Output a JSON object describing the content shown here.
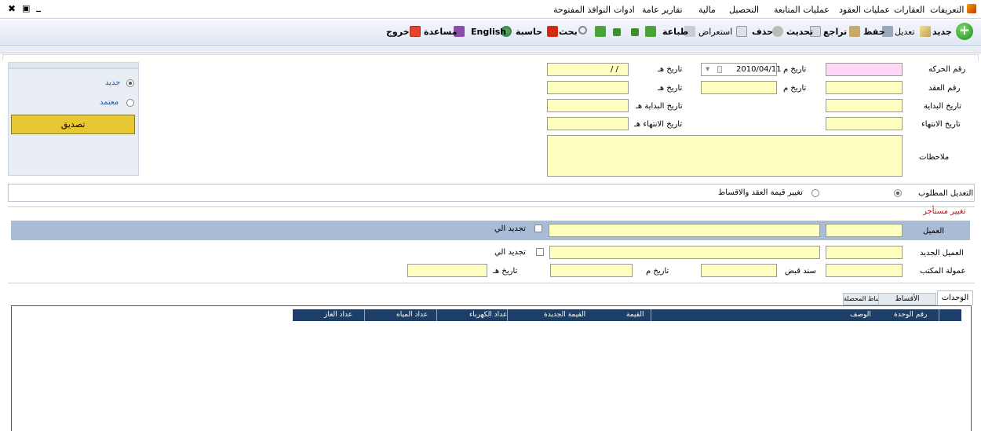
{
  "menubar": {
    "items": [
      "التعريفات",
      "العقارات",
      "عمليات العقود",
      "عمليات المتابعة",
      "التحصيل",
      "مالية",
      "تقارير عامة",
      "ادوات",
      "النوافذ المفتوحة"
    ],
    "window_controls": {
      "minimize": "_",
      "restore": "▣",
      "close": "✖"
    }
  },
  "toolbar": {
    "new": "جديد",
    "edit": "تعديل",
    "save": "حفظ",
    "undo": "تراجع",
    "refresh": "تحديث",
    "delete": "حذف",
    "browse": "استعراض",
    "print": "طباعة",
    "search": "بحث",
    "calculator": "حاسبة",
    "english": "English",
    "help": "مساعدة",
    "exit": "خروج"
  },
  "form": {
    "tx_no_label": "رقم الحركه",
    "date_g_label": "تاريخ م",
    "date_g_value": "2010/04/11",
    "date_h_label": "تاريخ هـ",
    "date_h_value": "/ /",
    "contract_no_label": "رقم العقد",
    "contract_date_g_label": "تاريخ م",
    "contract_date_h_label": "تاريخ هـ",
    "start_date_label": "تاريخ البداية",
    "start_date_h_label": "تاريخ البداية هـ",
    "end_date_label": "تاريخ الانتهاء",
    "end_date_h_label": "تاريخ الانتهاء هـ",
    "notes_label": "ملاحظات"
  },
  "status_panel": {
    "new_label": "جديد",
    "approved_label": "معتمد",
    "approve_button": "تصديق"
  },
  "modification": {
    "label": "التعديل المطلوب",
    "option": "تغيير قيمة العقد والاقساط"
  },
  "tenant_section": {
    "title": "تغيير مستأجر",
    "client_label": "العميل",
    "renew_to_label": "تجديد الي",
    "new_tenant_label": "العميل الجديد",
    "renew_to_label2": "تجديد الي",
    "office_commission_label": "عمولة المكتب",
    "receipt_label": "سند قبض",
    "date_g_label": "تاريخ م",
    "date_h_label": "تاريخ هـ"
  },
  "tabs": [
    "الوحدات",
    "الأقساط",
    "الأقساط المحصلة"
  ],
  "grid": {
    "columns": [
      "رقم الوحدة",
      "الوصف",
      "القيمة",
      "القيمة الجديدة",
      "عداد الكهرباء",
      "عداد المياه",
      "عداد الغاز"
    ]
  },
  "colors": {
    "yellow_field": "#ffffc0",
    "pink_field": "#ffd7f7",
    "grid_header": "#1d3e66",
    "approve_button": "#e8c832"
  }
}
